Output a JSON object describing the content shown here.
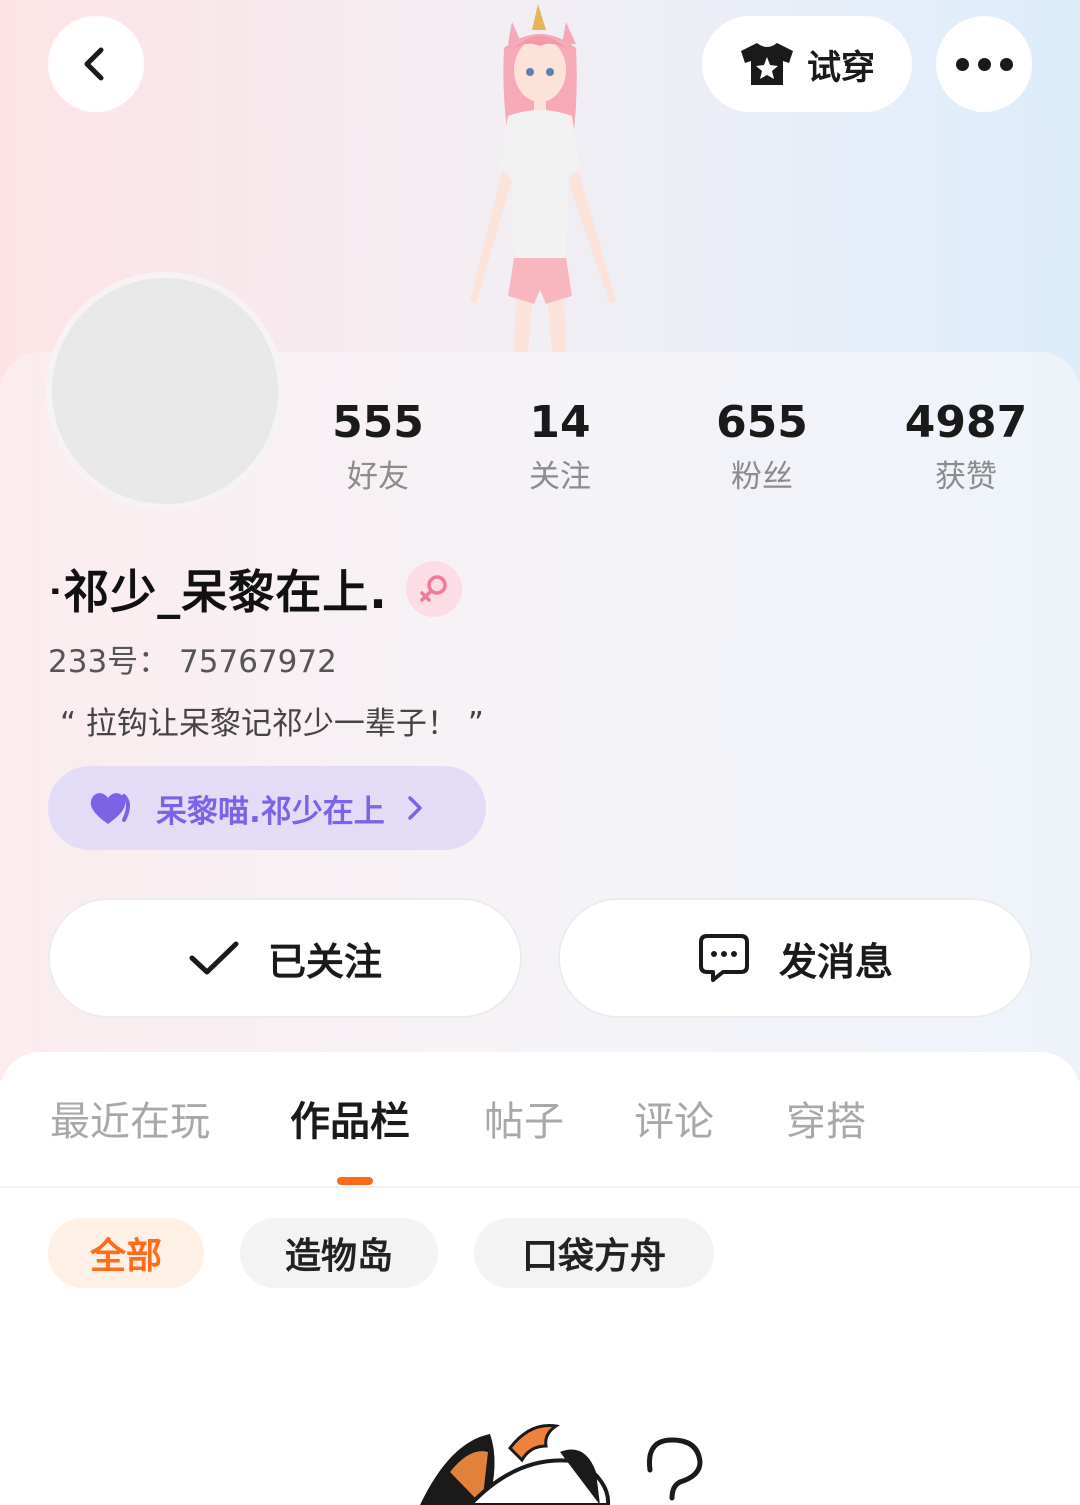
{
  "header": {
    "try_on_label": "试穿"
  },
  "stats": [
    {
      "value": "555",
      "label": "好友"
    },
    {
      "value": "14",
      "label": "关注"
    },
    {
      "value": "655",
      "label": "粉丝"
    },
    {
      "value": "4987",
      "label": "获赞"
    }
  ],
  "profile": {
    "nickname": "ᐧ祁少_呆黎在上.",
    "uid": "233号： 75767972",
    "bio": "“ 拉钩让呆黎记祁少一辈子！ ”",
    "gender_icon": "female-icon"
  },
  "cp": {
    "label": "呆黎喵.祁少在上"
  },
  "actions": {
    "follow_label": "已关注",
    "message_label": "发消息"
  },
  "tabs": [
    {
      "label": "最近在玩",
      "active": false
    },
    {
      "label": "作品栏",
      "active": true
    },
    {
      "label": "帖子",
      "active": false
    },
    {
      "label": "评论",
      "active": false
    },
    {
      "label": "穿搭",
      "active": false
    }
  ],
  "filters": [
    {
      "label": "全部",
      "active": true
    },
    {
      "label": "造物岛",
      "active": false
    },
    {
      "label": "口袋方舟",
      "active": false
    }
  ],
  "colors": {
    "accent": "#ff6b1a",
    "cp_text": "#7b63e6",
    "cp_bg": "#e2dcf6",
    "gender": "#f07a98"
  }
}
